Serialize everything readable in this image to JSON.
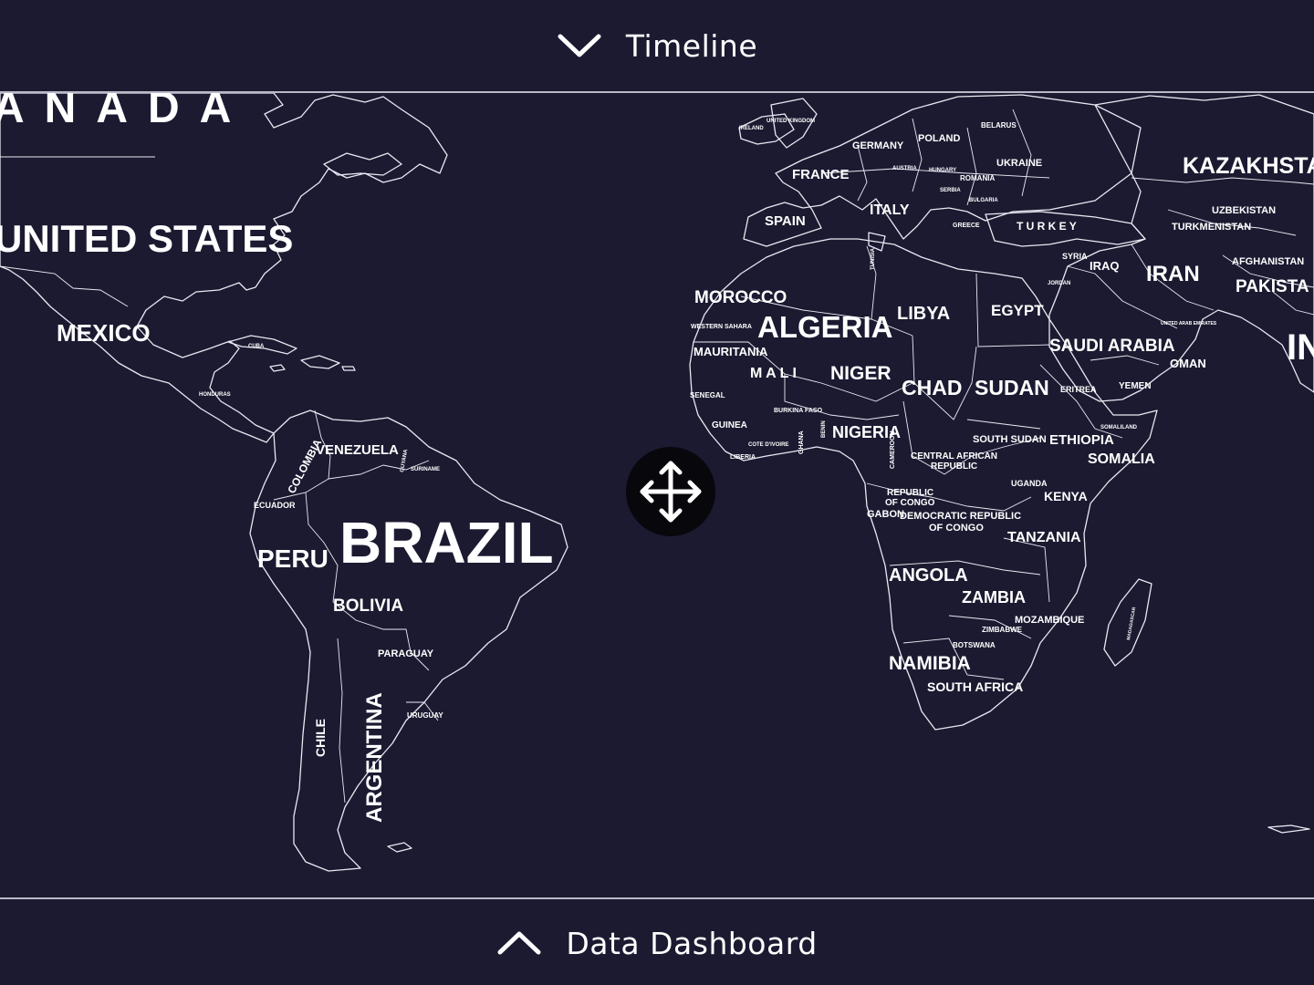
{
  "top_panel": {
    "label": "Timeline",
    "icon": "chevron-down-icon"
  },
  "bottom_panel": {
    "label": "Data Dashboard",
    "icon": "chevron-up-icon"
  },
  "map": {
    "pan_control_icon": "move-arrows-icon",
    "colors": {
      "background": "#1b1a31",
      "land_outline": "#e9e9f2",
      "labels": "#ffffff"
    },
    "labels": {
      "canada": "ANADA",
      "united_states": "UNITED STATES",
      "mexico": "MEXICO",
      "cuba": "CUBA",
      "honduras": "HONDURAS",
      "venezuela": "VENEZUELA",
      "colombia": "COLOMBIA",
      "ecuador": "ECUADOR",
      "guyana": "GUYANA",
      "suriname": "SURINAME",
      "peru": "PERU",
      "brazil": "BRAZIL",
      "bolivia": "BOLIVIA",
      "paraguay": "PARAGUAY",
      "uruguay": "URUGUAY",
      "chile": "CHILE",
      "argentina": "ARGENTINA",
      "ireland": "IRELAND",
      "united_kingdom": "UNITED KINGDOM",
      "france": "FRANCE",
      "spain": "SPAIN",
      "germany": "GERMANY",
      "poland": "POLAND",
      "belarus": "BELARUS",
      "ukraine": "UKRAINE",
      "romania": "ROMANIA",
      "hungary": "HUNGARY",
      "austria": "AUSTRIA",
      "serbia": "SERBIA",
      "bulgaria": "BULGARIA",
      "italy": "ITALY",
      "greece": "GREECE",
      "turkey": "T U R K E Y",
      "kazakhstan": "KAZAKHSTA",
      "uzbekistan": "UZBEKISTAN",
      "turkmenistan": "TURKMENISTAN",
      "afghanistan": "AFGHANISTAN",
      "pakistan": "PAKISTA",
      "india": "IN",
      "iran": "IRAN",
      "iraq": "IRAQ",
      "syria": "SYRIA",
      "jordan": "JORDAN",
      "tunisia": "TUNISIA",
      "morocco": "MOROCCO",
      "western_sahara": "WESTERN SAHARA",
      "algeria": "ALGERIA",
      "libya": "LIBYA",
      "egypt": "EGYPT",
      "saudi_arabia": "SAUDI ARABIA",
      "uae": "UNITED ARAB EMIRATES",
      "oman": "OMAN",
      "yemen": "YEMEN",
      "mauritania": "MAURITANIA",
      "mali": "M A L I",
      "niger": "NIGER",
      "chad": "CHAD",
      "sudan": "SUDAN",
      "eritrea": "ERITREA",
      "senegal": "SENEGAL",
      "burkina_faso": "BURKINA FASO",
      "guinea": "GUINEA",
      "liberia": "LIBERIA",
      "cote_divoire": "COTE D'IVOIRE",
      "ghana": "GHANA",
      "benin": "BENIN",
      "nigeria": "NIGERIA",
      "cameroon": "CAMEROON",
      "south_sudan": "SOUTH SUDAN",
      "ethiopia": "ETHIOPIA",
      "somaliland": "SOMALILAND",
      "somalia": "SOMALIA",
      "car_line1": "CENTRAL AFRICAN",
      "car_line2": "REPUBLIC",
      "uganda": "UGANDA",
      "kenya": "KENYA",
      "roc_line1": "REPUBLIC",
      "roc_line2": "OF CONGO",
      "gabon": "GABON",
      "drc_line1": "DEMOCRATIC REPUBLIC",
      "drc_line2": "OF CONGO",
      "tanzania": "TANZANIA",
      "angola": "ANGOLA",
      "zambia": "ZAMBIA",
      "mozambique": "MOZAMBIQUE",
      "zimbabwe": "ZIMBABWE",
      "botswana": "BOTSWANA",
      "namibia": "NAMIBIA",
      "south_africa": "SOUTH AFRICA",
      "madagascar": "MADAGASCAR"
    }
  }
}
